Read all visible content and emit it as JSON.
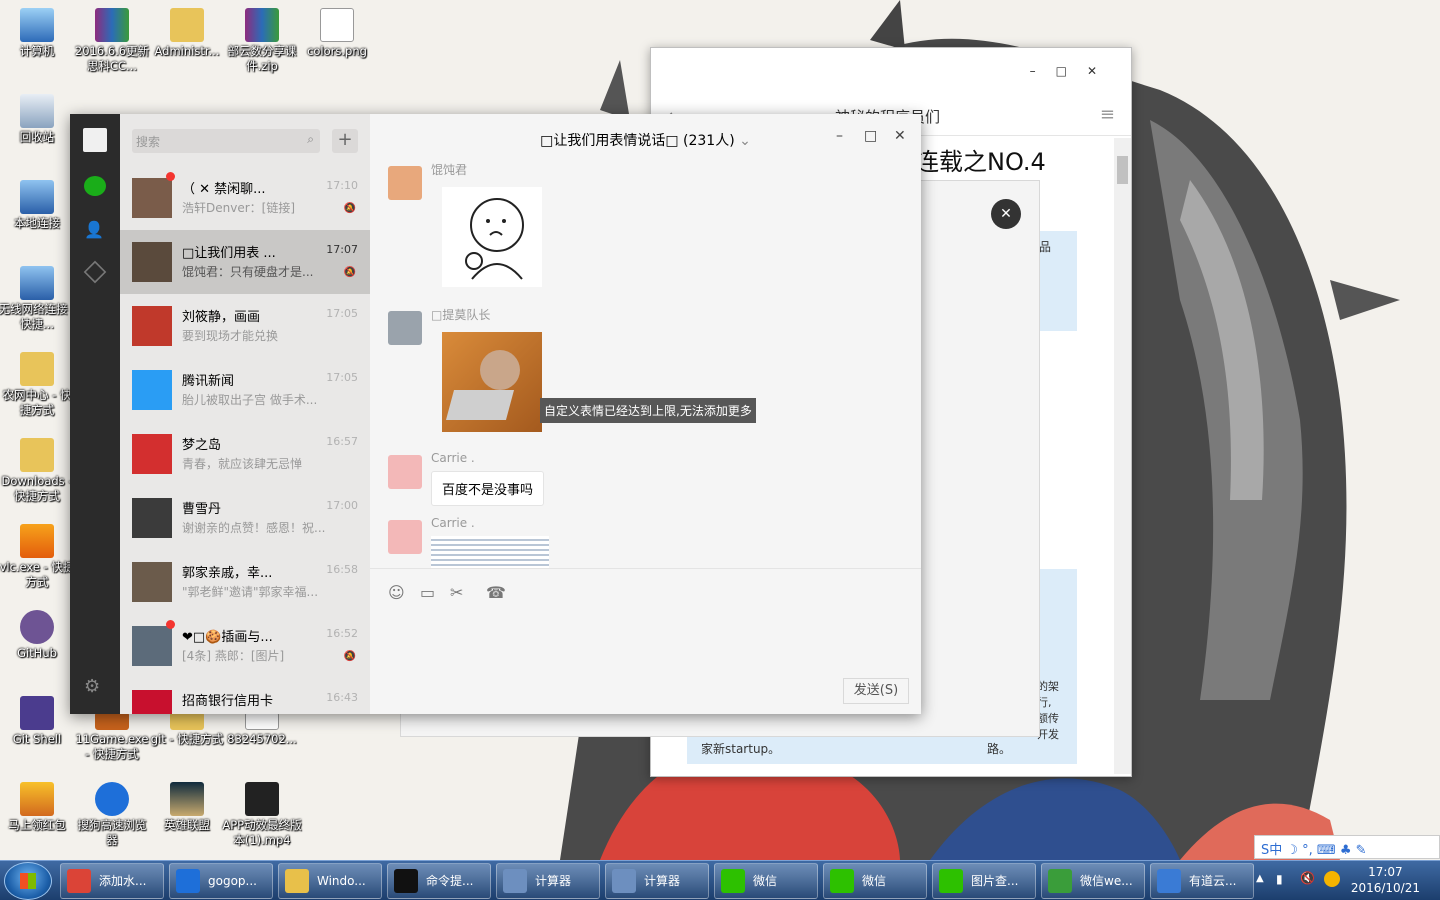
{
  "desktop_icons": [
    {
      "label": "计算机"
    },
    {
      "label": "2016.6.6更新 思科CC..."
    },
    {
      "label": "Administr..."
    },
    {
      "label": "部云数分享课件.zip"
    },
    {
      "label": "colors.png"
    },
    {
      "label": "回收站"
    },
    {
      "label": "本地连接"
    },
    {
      "label": "无线网络连接 - 快捷..."
    },
    {
      "label": "农网中心 - 快捷方式"
    },
    {
      "label": "Downloads - 快捷方式"
    },
    {
      "label": "vlc.exe - 快捷方式"
    },
    {
      "label": "GitHub"
    },
    {
      "label": "Git Shell"
    },
    {
      "label": "11Game.exe - 快捷方式"
    },
    {
      "label": "git - 快捷方式"
    },
    {
      "label": "83245702..."
    },
    {
      "label": "马上领红包"
    },
    {
      "label": "搜狗高速浏览器"
    },
    {
      "label": "英雄联盟"
    },
    {
      "label": "APP动效最终版本(1).mp4"
    }
  ],
  "browser": {
    "title": "神秘的程序员们",
    "headline": "连载之NO.4",
    "side_text_1": "品",
    "bottom_text": "家新startup。",
    "bottom_text_2": "路。",
    "right_text": "的架\n行,\n额传\n开发"
  },
  "wechat": {
    "search_placeholder": "搜索",
    "plus_label": "+",
    "conversations": [
      {
        "name": "（ ✕ 禁闲聊...",
        "msg": "浩轩Denver：[链接]",
        "time": "17:10",
        "muted": true,
        "dot": true,
        "avatar_color": "#7a5c4a"
      },
      {
        "name": "□让我们用表 ...",
        "msg": "馄饨君：只有硬盘才是...",
        "time": "17:07",
        "muted": true,
        "dot": false,
        "avatar_color": "#5a4a3c"
      },
      {
        "name": "刘筱静，画画",
        "msg": "要到现场才能兑换",
        "time": "17:05",
        "muted": false,
        "dot": false,
        "avatar_color": "#c0392b"
      },
      {
        "name": "腾讯新闻",
        "msg": "胎儿被取出子宫 做手术...",
        "time": "17:05",
        "muted": false,
        "dot": false,
        "avatar_color": "#2a9df4"
      },
      {
        "name": "梦之岛",
        "msg": "青春，就应该肆无忌惮",
        "time": "16:57",
        "muted": false,
        "dot": false,
        "avatar_color": "#d32f2f"
      },
      {
        "name": "曹雪丹",
        "msg": "谢谢亲的点赞！感恩！祝...",
        "time": "17:00",
        "muted": false,
        "dot": false,
        "avatar_color": "#3b3b3b"
      },
      {
        "name": "郭家亲戚，幸...",
        "msg": "\"郭老鲜\"邀请\"郭家幸福...",
        "time": "16:58",
        "muted": false,
        "dot": false,
        "avatar_color": "#6b5b4b"
      },
      {
        "name": "❤□🍪插画与...",
        "msg": "[4条] 燕郎：[图片]",
        "time": "16:52",
        "muted": true,
        "dot": true,
        "avatar_color": "#5c6b7a"
      },
      {
        "name": "招商银行信用卡",
        "msg": "",
        "time": "16:43",
        "muted": false,
        "dot": false,
        "avatar_color": "#c8102e"
      }
    ],
    "chat": {
      "title": "□让我们用表情说话□ (231人)",
      "messages": [
        {
          "sender": "馄饨君"
        },
        {
          "sender": "□提莫队长"
        },
        {
          "sender": "Carrie .",
          "text": "百度不是没事吗"
        },
        {
          "sender": "Carrie ."
        }
      ],
      "tooltip": "自定义表情已经达到上限,无法添加更多",
      "send_label": "发送(S)"
    }
  },
  "taskbar": {
    "buttons": [
      {
        "label": "添加水...",
        "color": "#db4437"
      },
      {
        "label": "gogop...",
        "color": "#1e6fd9"
      },
      {
        "label": "Windo...",
        "color": "#e8c04a"
      },
      {
        "label": "命令提...",
        "color": "#111111"
      },
      {
        "label": "计算器",
        "color": "#6d8fbf"
      },
      {
        "label": "计算器",
        "color": "#6d8fbf"
      },
      {
        "label": "微信",
        "color": "#2dc100"
      },
      {
        "label": "微信",
        "color": "#2dc100"
      },
      {
        "label": "图片查...",
        "color": "#2dc100"
      },
      {
        "label": "微信we...",
        "color": "#3a9d3a"
      },
      {
        "label": "有道云...",
        "color": "#3a7bd5"
      }
    ],
    "time": "17:07",
    "date": "2016/10/21",
    "ime_text": "S中 ☽ °, ⌨ ♣ ✎"
  }
}
